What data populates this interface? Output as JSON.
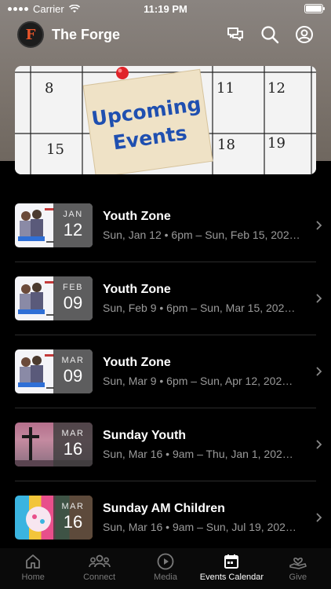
{
  "status_bar": {
    "carrier": "Carrier",
    "time": "11:19 PM"
  },
  "app_bar": {
    "title": "The Forge",
    "logo_letter": "F",
    "actions": [
      "messages-icon",
      "search-icon",
      "profile-icon"
    ]
  },
  "banner": {
    "line1": "Upcoming",
    "line2": "Events",
    "calendar_numbers": [
      "8",
      "11",
      "12",
      "15",
      "18",
      "19"
    ]
  },
  "events": [
    {
      "title": "Youth Zone",
      "subtitle": "Sun, Jan 12 • 6pm – Sun, Feb 15, 202…",
      "month": "JAN",
      "day": "12",
      "thumb": "youth"
    },
    {
      "title": "Youth Zone",
      "subtitle": "Sun, Feb 9 • 6pm – Sun, Mar 15, 202…",
      "month": "FEB",
      "day": "09",
      "thumb": "youth"
    },
    {
      "title": "Youth Zone",
      "subtitle": "Sun, Mar 9 • 6pm – Sun, Apr 12, 202…",
      "month": "MAR",
      "day": "09",
      "thumb": "youth"
    },
    {
      "title": "Sunday Youth",
      "subtitle": "Sun, Mar 16 • 9am – Thu, Jan 1, 202…",
      "month": "MAR",
      "day": "16",
      "thumb": "cross"
    },
    {
      "title": "Sunday AM Children",
      "subtitle": "Sun, Mar 16 • 9am – Sun, Jul 19, 202…",
      "month": "MAR",
      "day": "16",
      "thumb": "kids"
    }
  ],
  "tabs": [
    {
      "label": "Home",
      "icon": "home-icon",
      "active": false
    },
    {
      "label": "Connect",
      "icon": "people-icon",
      "active": false
    },
    {
      "label": "Media",
      "icon": "play-icon",
      "active": false
    },
    {
      "label": "Events Calendar",
      "icon": "calendar-icon",
      "active": true
    },
    {
      "label": "Give",
      "icon": "give-icon",
      "active": false
    }
  ],
  "colors": {
    "background": "#000000",
    "header": "#7c746d",
    "accent": "#e8542a",
    "banner_text": "#1f4fb0"
  }
}
